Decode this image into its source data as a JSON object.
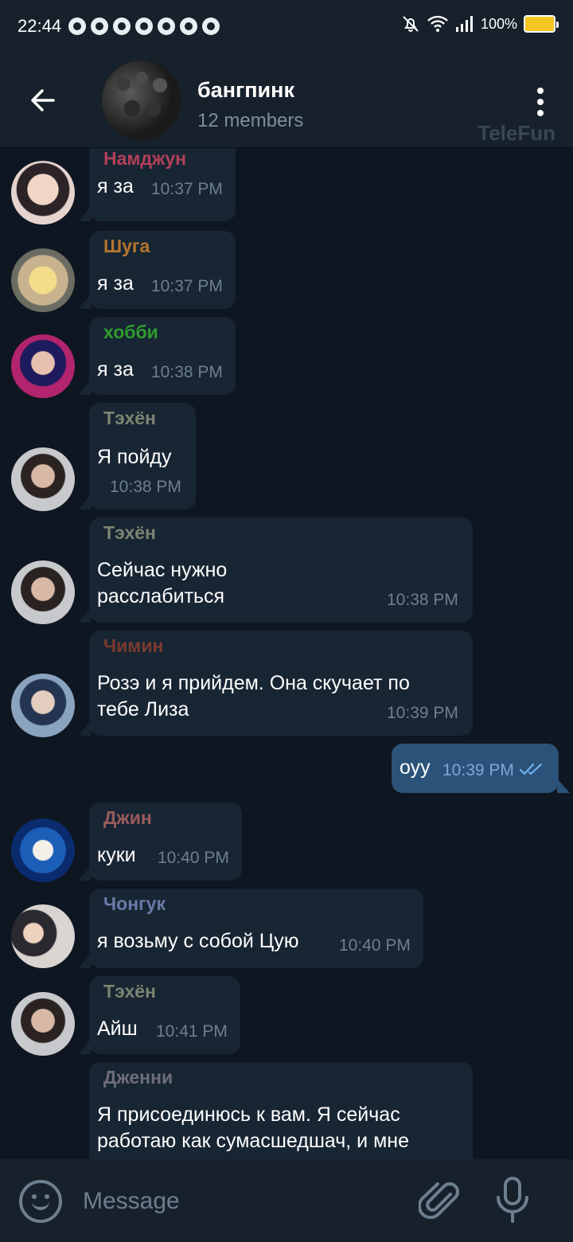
{
  "status_bar": {
    "time": "22:44",
    "battery": "100%",
    "icons": [
      "messenger-icon",
      "chrome-icon",
      "chrome-icon",
      "chrome-icon",
      "chrome-icon",
      "chrome-icon",
      "chrome-icon",
      "bell-off-icon",
      "wifi-icon",
      "signal-icon",
      "battery-charging-icon"
    ]
  },
  "header": {
    "title": "бангпинк",
    "subtitle": "12 members",
    "watermark": "TeleFun",
    "back_icon": "arrow-left-icon",
    "menu_icon": "more-vertical-icon"
  },
  "messages": [
    {
      "sender": "Намджун",
      "sender_color": "#b3405a",
      "text": "я за",
      "time": "10:37 PM"
    },
    {
      "sender": "Шуга",
      "sender_color": "#b5762f",
      "text": "я за",
      "time": "10:37 PM"
    },
    {
      "sender": "хобби",
      "sender_color": "#2f9c2f",
      "text": "я за",
      "time": "10:38 PM"
    },
    {
      "sender": "Тэхён",
      "sender_color": "#7c8471",
      "text": "Я пойду",
      "time": "10:38 PM"
    },
    {
      "sender": "Тэхён",
      "sender_color": "#7c8471",
      "text": "Сейчас нужно\nрасслабиться",
      "time": "10:38 PM"
    },
    {
      "sender": "Чимин",
      "sender_color": "#7a3b2f",
      "text": "Розэ и я прийдем.  Она скучает по\nтебе Лиза",
      "time": "10:39 PM"
    },
    {
      "sender": "",
      "text": "оуу",
      "time": "10:39 PM",
      "outgoing": true,
      "read_icon": "double-check-icon"
    },
    {
      "sender": "Джин",
      "sender_color": "#9a5a5a",
      "text": "куки",
      "time": "10:40 PM"
    },
    {
      "sender": "Чонгук",
      "sender_color": "#6a7aa8",
      "text": "я возьму с собой Цую",
      "time": "10:40 PM"
    },
    {
      "sender": "Тэхён",
      "sender_color": "#7c8471",
      "text": "Айш",
      "time": "10:41 PM"
    },
    {
      "sender": "Дженни",
      "sender_color": "#6e6e78",
      "text": "Я присоединюсь к вам. Я сейчас\nработаю как сумасшедшач, и мне",
      "time": ""
    }
  ],
  "input": {
    "placeholder": "Message",
    "emoji_icon": "emoji-icon",
    "attach_icon": "paperclip-icon",
    "mic_icon": "microphone-icon"
  }
}
